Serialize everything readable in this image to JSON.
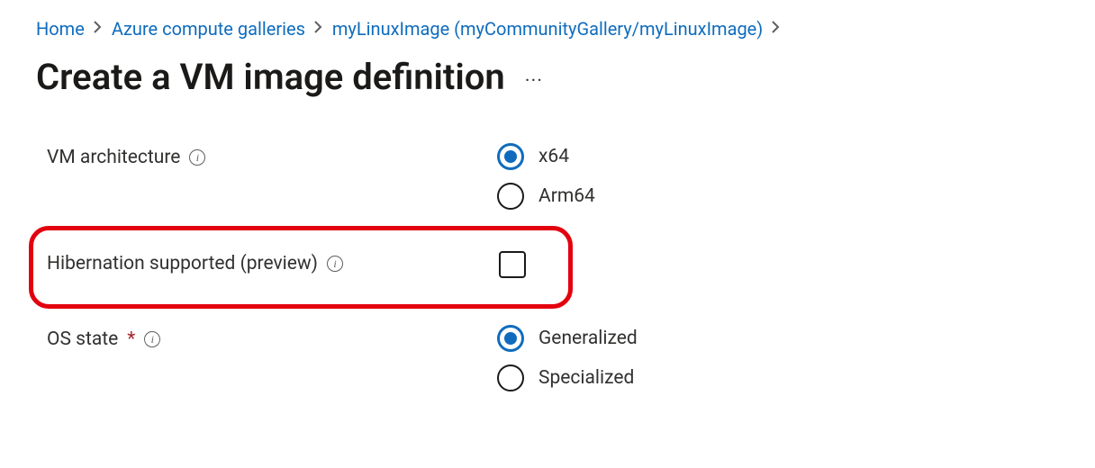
{
  "breadcrumb": {
    "home": "Home",
    "galleries": "Azure compute galleries",
    "current": "myLinuxImage (myCommunityGallery/myLinuxImage)"
  },
  "page": {
    "title": "Create a VM image definition"
  },
  "form": {
    "vm_arch": {
      "label": "VM architecture",
      "options": {
        "x64": "x64",
        "arm64": "Arm64"
      }
    },
    "hibernation": {
      "label": "Hibernation supported (preview)"
    },
    "os_state": {
      "label": "OS state",
      "options": {
        "generalized": "Generalized",
        "specialized": "Specialized"
      }
    }
  }
}
